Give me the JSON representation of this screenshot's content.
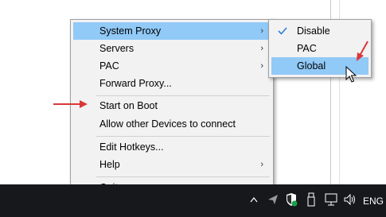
{
  "menu": {
    "items": [
      {
        "label": "System Proxy",
        "has_submenu": true,
        "highlighted": true
      },
      {
        "label": "Servers",
        "has_submenu": true
      },
      {
        "label": "PAC",
        "has_submenu": true
      },
      {
        "label": "Forward Proxy..."
      },
      {
        "label": "Start on Boot"
      },
      {
        "label": "Allow other Devices to connect"
      },
      {
        "label": "Edit Hotkeys..."
      },
      {
        "label": "Help",
        "has_submenu": true
      },
      {
        "label": "Quit"
      }
    ]
  },
  "submenu": {
    "items": [
      {
        "label": "Disable",
        "checked": true
      },
      {
        "label": "PAC"
      },
      {
        "label": "Global",
        "highlighted": true
      }
    ]
  },
  "taskbar": {
    "language": "ENG",
    "icons": [
      "chevron-up-icon",
      "paper-plane-icon",
      "shield-icon",
      "usb-drive-icon",
      "network-icon",
      "volume-icon"
    ]
  },
  "colors": {
    "highlight": "#91c9f7",
    "annotation_arrow": "#d9383a",
    "taskbar": "#16181b"
  }
}
